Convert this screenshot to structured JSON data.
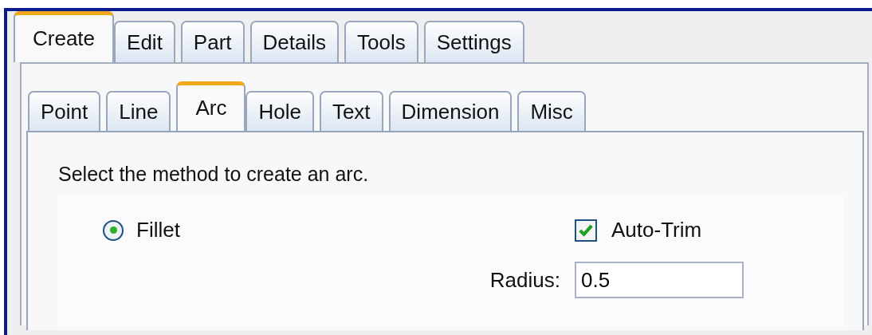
{
  "main_tabs": [
    {
      "label": "Create",
      "selected": true
    },
    {
      "label": "Edit",
      "selected": false
    },
    {
      "label": "Part",
      "selected": false
    },
    {
      "label": "Details",
      "selected": false
    },
    {
      "label": "Tools",
      "selected": false
    },
    {
      "label": "Settings",
      "selected": false
    }
  ],
  "sub_tabs": [
    {
      "label": "Point",
      "selected": false
    },
    {
      "label": "Line",
      "selected": false
    },
    {
      "label": "Arc",
      "selected": true
    },
    {
      "label": "Hole",
      "selected": false
    },
    {
      "label": "Text",
      "selected": false
    },
    {
      "label": "Dimension",
      "selected": false
    },
    {
      "label": "Misc",
      "selected": false
    }
  ],
  "panel": {
    "instruction": "Select the method to create an arc.",
    "methods": [
      {
        "label": "Fillet",
        "selected": true
      }
    ],
    "auto_trim": {
      "label": "Auto-Trim",
      "checked": true
    },
    "radius": {
      "label": "Radius:",
      "value": "0.5"
    }
  }
}
